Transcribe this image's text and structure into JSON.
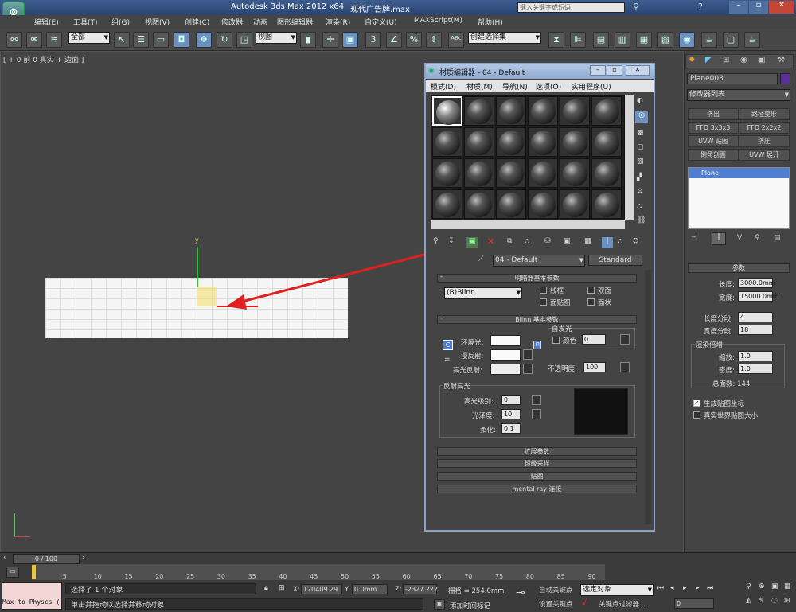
{
  "titlebar": {
    "app": "Autodesk 3ds Max  2012 x64",
    "file": "现代广告牌.max",
    "search_placeholder": "键入关键字或短语"
  },
  "menu": [
    "编辑(E)",
    "工具(T)",
    "组(G)",
    "视图(V)",
    "创建(C)",
    "修改器",
    "动画",
    "图形编辑器",
    "渲染(R)",
    "自定义(U)",
    "MAXScript(M)",
    "帮助(H)"
  ],
  "toolbar": {
    "selection_filter": "全部",
    "ref_coord": "视图",
    "named_selection": "创建选择集"
  },
  "viewport": {
    "label": "[ + 0 前 0 真实 + 边面 ]",
    "axis_y": "y"
  },
  "cmdpanel": {
    "object_name": "Plane003",
    "modifier_list": "修改器列表",
    "buttons": [
      "挤出",
      "路径变形",
      "FFD 3x3x3",
      "FFD 2x2x2",
      "UVW 贴图",
      "挤压",
      "倒角剖面",
      "UVW 展开"
    ],
    "stack_item": "Plane",
    "params_title": "参数",
    "length_label": "长度:",
    "length_value": "3000.0mm",
    "width_label": "宽度:",
    "width_value": "15000.0mm",
    "length_segs_label": "长度分段:",
    "length_segs_value": "4",
    "width_segs_label": "宽度分段:",
    "width_segs_value": "18",
    "render_mult_title": "渲染倍增",
    "scale_label": "缩放:",
    "scale_value": "1.0",
    "density_label": "密度:",
    "density_value": "1.0",
    "total_faces": "总面数: 144",
    "gen_map_coords": "生成贴图坐标",
    "real_world_map": "真实世界贴图大小"
  },
  "mateditor": {
    "title": "材质编辑器 - 04 - Default",
    "menu": [
      "模式(D)",
      "材质(M)",
      "导航(N)",
      "选项(O)",
      "实用程序(U)"
    ],
    "material_name": "04 - Default",
    "material_type": "Standard",
    "shader_rollout": "明暗器基本参数",
    "shader": "(B)Blinn",
    "wire": "线框",
    "two_sided": "双面",
    "face_map": "面贴图",
    "faceted": "面状",
    "blinn_rollout": "Blinn 基本参数",
    "self_illum": "自发光",
    "color_label": "颜色",
    "color_value": "0",
    "ambient": "环境光:",
    "diffuse": "漫反射:",
    "specular": "高光反射:",
    "opacity_label": "不透明度:",
    "opacity_value": "100",
    "spec_highlights": "反射高光",
    "spec_level_label": "高光级别:",
    "spec_level_value": "0",
    "gloss_label": "光泽度:",
    "gloss_value": "10",
    "soften_label": "柔化:",
    "soften_value": "0.1",
    "rollouts": [
      "扩展参数",
      "超级采样",
      "贴图",
      "mental ray 连接"
    ]
  },
  "status": {
    "time": "0 / 100",
    "selected": "选择了 1 个对象",
    "prompt": "单击并拖动以选择并移动对象",
    "x_label": "X:",
    "x_value": "120409.29",
    "y_label": "Y:",
    "y_value": "0.0mm",
    "z_label": "Z:",
    "z_value": "-2327.222",
    "grid": "栅格 = 254.0mm",
    "add_time_tag": "添加时间标记",
    "auto_key": "自动关键点",
    "set_key": "设置关键点",
    "selected_obj": "选定对象",
    "key_filters": "关键点过滤器...",
    "frame": "0",
    "listener": "Max to Physcs (",
    "ticks": [
      "0",
      "5",
      "10",
      "15",
      "20",
      "25",
      "30",
      "35",
      "40",
      "45",
      "50",
      "55",
      "60",
      "65",
      "70",
      "75",
      "80",
      "85",
      "90"
    ]
  },
  "colors": {
    "accent_red": "#e02020",
    "title_blue": "#2a4470"
  }
}
